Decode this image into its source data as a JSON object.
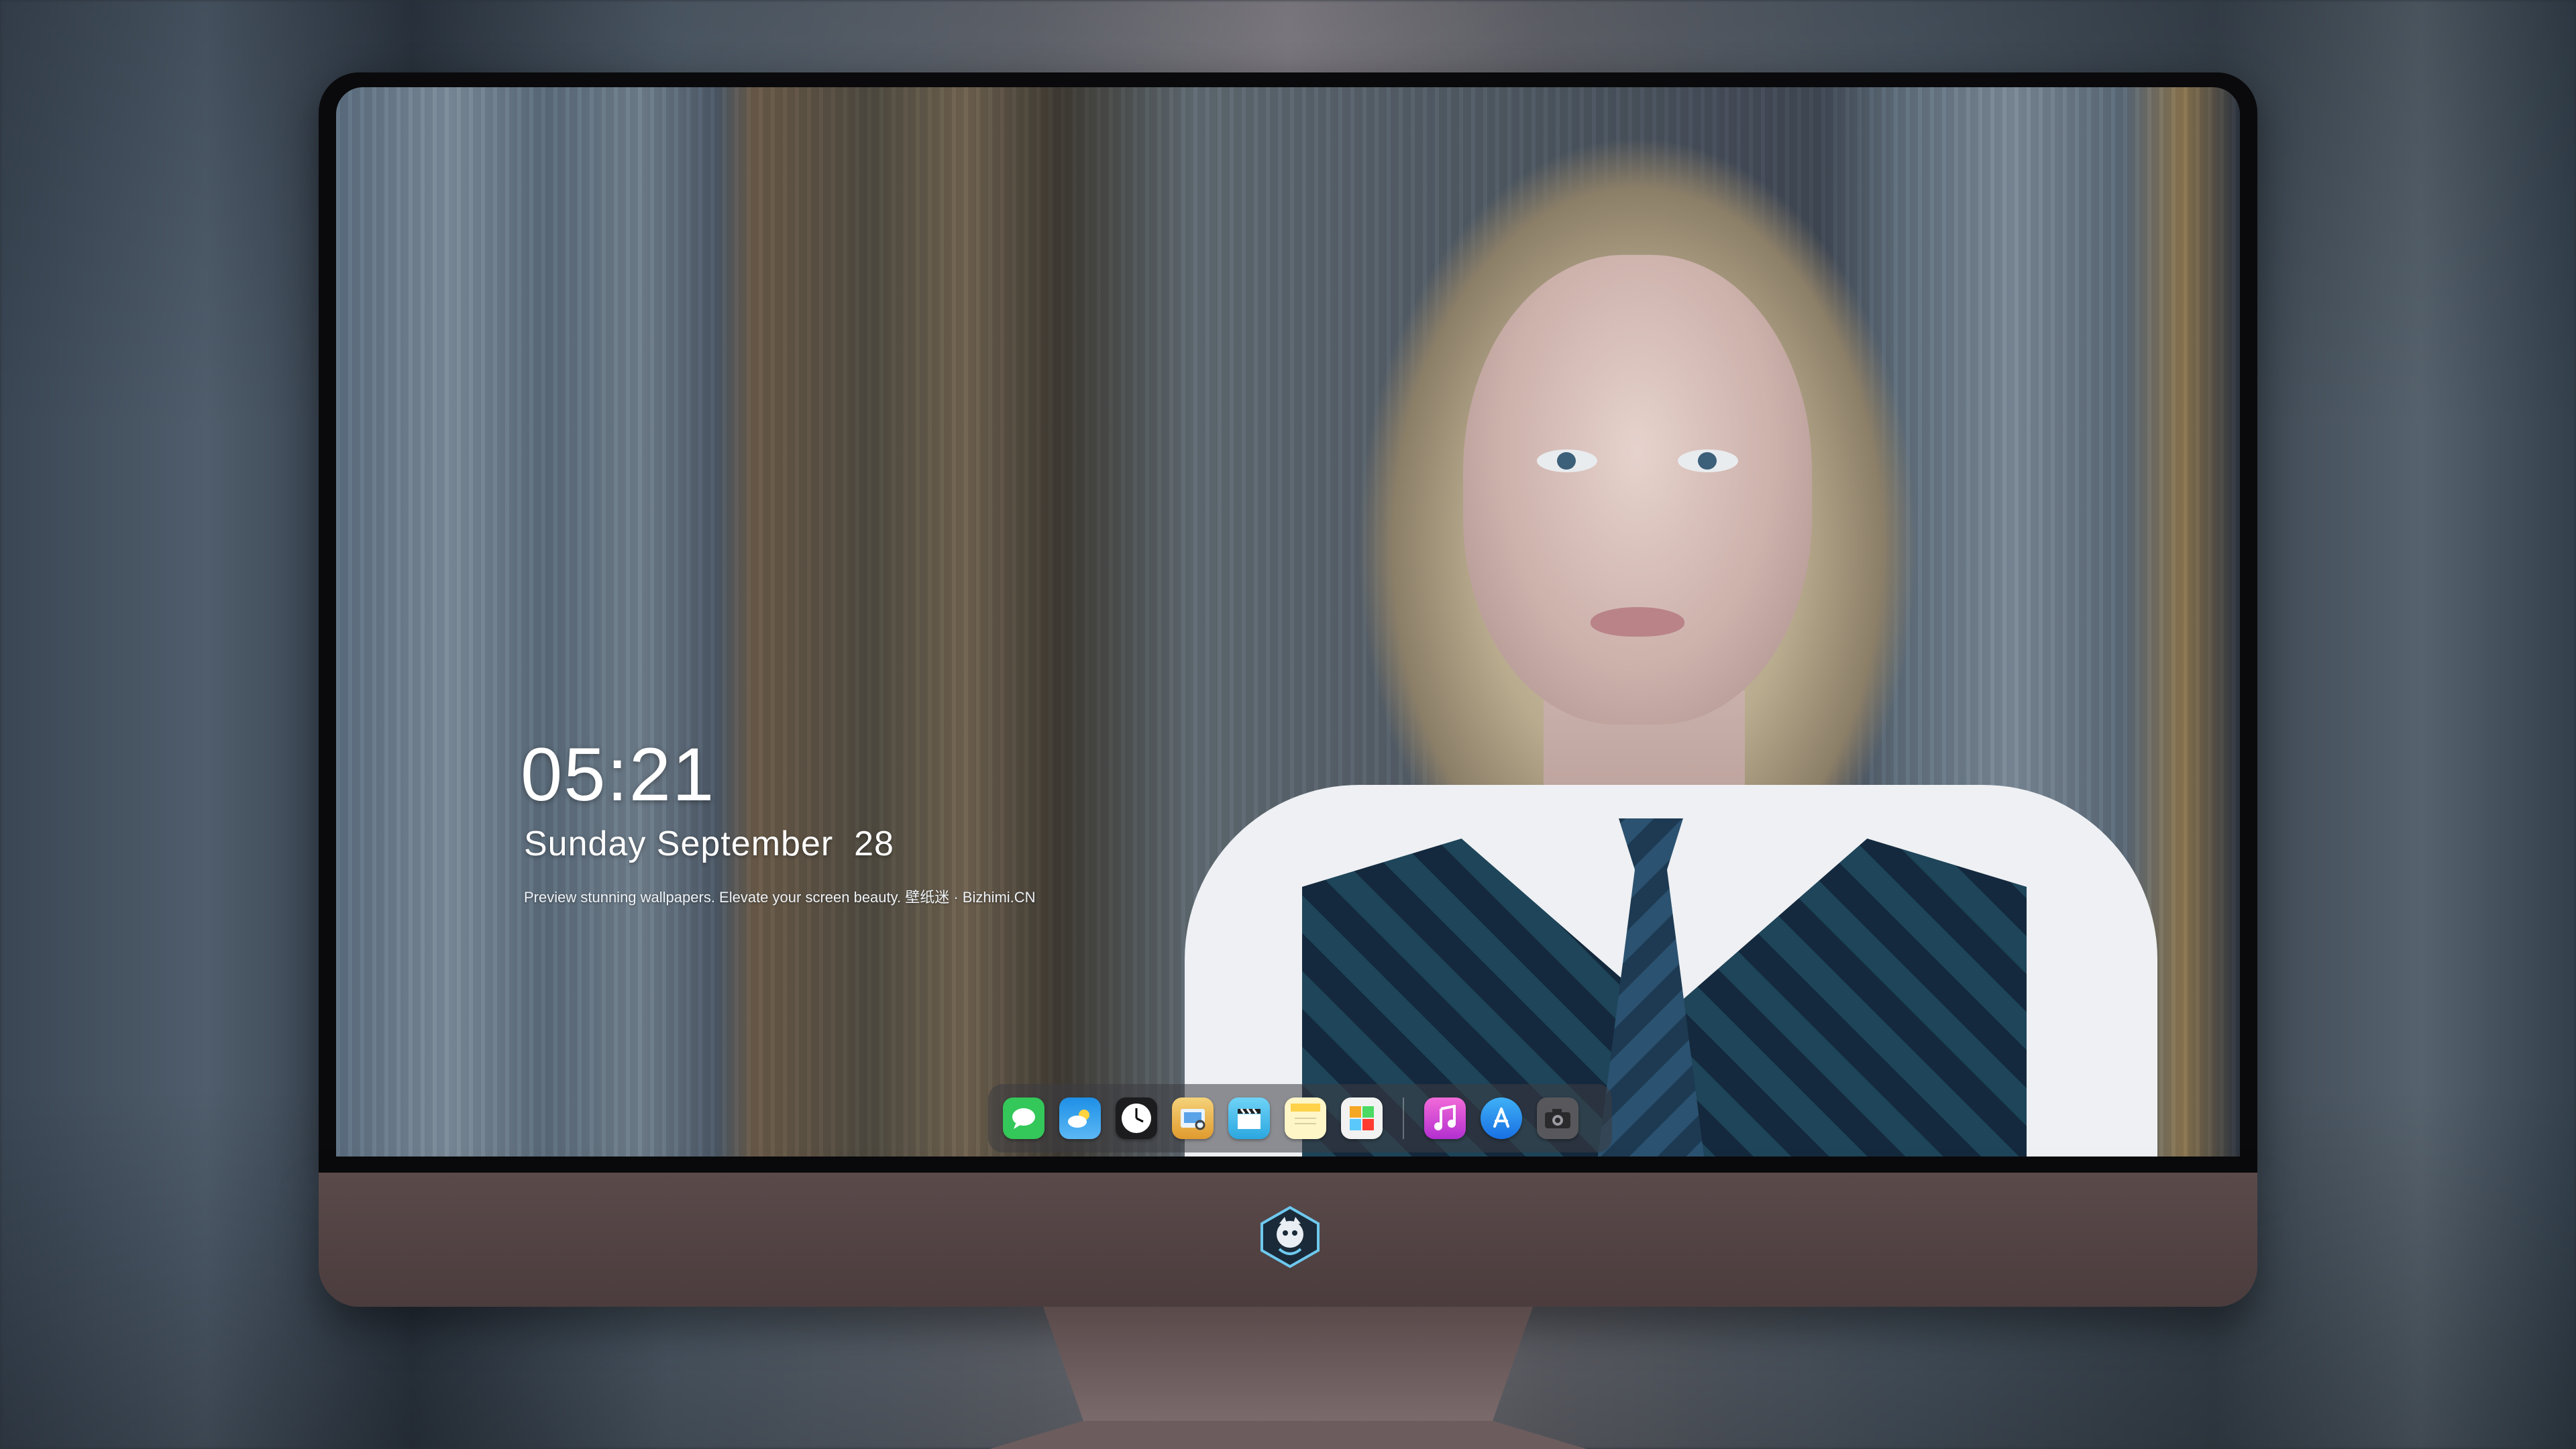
{
  "lockscreen": {
    "time": "05:21",
    "date": "Sunday September  28",
    "tagline": "Preview stunning wallpapers. Elevate your screen beauty. 壁纸迷 · Bizhimi.CN"
  },
  "dock": {
    "apps": [
      {
        "name": "messages",
        "icon": "speech-bubble-icon",
        "color": "#34c759"
      },
      {
        "name": "weather",
        "icon": "cloud-sun-icon",
        "color": "#2f9bea"
      },
      {
        "name": "clock",
        "icon": "clock-icon",
        "color": "#1c1c1e"
      },
      {
        "name": "preview",
        "icon": "preview-icon",
        "color": "#e8b64a"
      },
      {
        "name": "clips",
        "icon": "clapperboard-icon",
        "color": "#5ac8fa"
      },
      {
        "name": "notes",
        "icon": "notes-icon",
        "color": "#ffd84a"
      },
      {
        "name": "photo-booth",
        "icon": "photo-grid-icon",
        "color": "#f2f2f2"
      },
      {
        "name": "itunes",
        "icon": "music-note-icon",
        "color": "#d63dd6"
      },
      {
        "name": "app-store",
        "icon": "app-store-icon",
        "color": "#2f8cf0"
      },
      {
        "name": "camera",
        "icon": "camera-icon",
        "color": "#6b6b70"
      }
    ]
  },
  "colors": {
    "chin": "#4b3c3d",
    "bezel": "#0a0a0c",
    "text": "#ffffff"
  }
}
